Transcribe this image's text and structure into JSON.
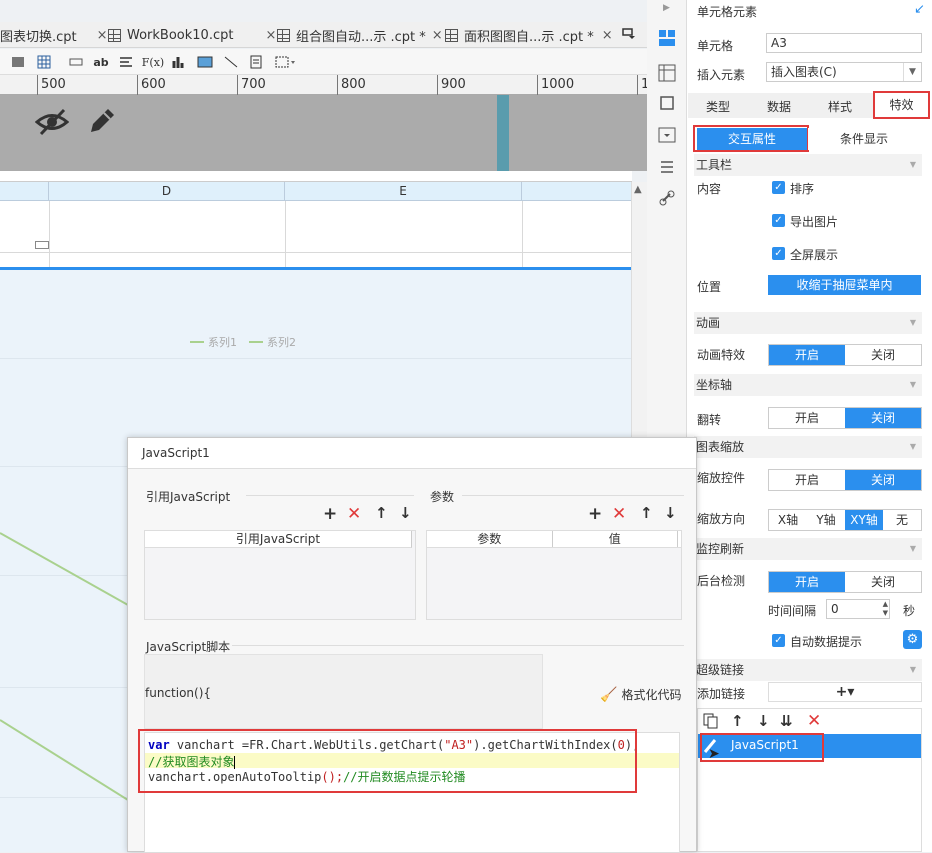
{
  "tabs": [
    {
      "label": "图表切换.cpt",
      "close": "×"
    },
    {
      "label": "WorkBook10.cpt",
      "close": "×"
    },
    {
      "label": "组合图自动...示  .cpt *",
      "close": "×"
    },
    {
      "label": "面积图图自...示  .cpt *",
      "close": "×"
    }
  ],
  "toolbar": {
    "ab": "ab",
    "fx": "F(x)"
  },
  "ruler": {
    "ticks": [
      "500",
      "600",
      "700",
      "800",
      "900",
      "1000",
      "1"
    ]
  },
  "sheet": {
    "columns": [
      "D",
      "E"
    ],
    "legend": [
      "系列1",
      "系列2"
    ]
  },
  "panel": {
    "title": "单元格元素",
    "cell_label": "单元格",
    "cell_value": "A3",
    "insert_label": "插入元素",
    "insert_value": "插入图表(C)",
    "tabs": [
      "类型",
      "数据",
      "样式",
      "特效"
    ],
    "subtabs": [
      "交互属性",
      "条件显示"
    ],
    "toolbar_section": "工具栏",
    "content_label": "内容",
    "checks": [
      "排序",
      "导出图片",
      "全屏展示"
    ],
    "position_label": "位置",
    "position_value": "收缩于抽屉菜单内",
    "anim_section": "动画",
    "anim_label": "动画特效",
    "on": "开启",
    "off": "关闭",
    "axis_section": "坐标轴",
    "flip_label": "翻转",
    "zoom_section": "图表缩放",
    "zoom_ctrl_label": "缩放控件",
    "zoom_dir_label": "缩放方向",
    "zoom_dirs": [
      "X轴",
      "Y轴",
      "XY轴",
      "无"
    ],
    "monitor_section": "监控刷新",
    "backend_label": "后台检测",
    "interval_label": "时间间隔",
    "interval_value": "0",
    "interval_unit": "秒",
    "auto_tip": "自动数据提示",
    "link_section": "超级链接",
    "add_link": "添加链接",
    "add_btn": "+▾",
    "link_item": "JavaScript1"
  },
  "dialog": {
    "title": "JavaScript1",
    "ref_section": "引用JavaScript",
    "param_section": "参数",
    "ref_col": "引用JavaScript",
    "param_col": "参数",
    "value_col": "值",
    "script_section": "JavaScript脚本",
    "func_head": "function(){",
    "format_btn": "格式化代码",
    "code": {
      "l1_kw": "var",
      "l1_a": " vanchart =FR.Chart.WebUtils.getChart(",
      "l1_str": "\"A3\"",
      "l1_b": ").getChartWithIndex(",
      "l1_num": "0",
      "l1_c": ");",
      "l2": "//获取图表对象",
      "l3_a": "vanchart.openAutoTooltip",
      "l3_b": "();",
      "l3_c": "//开启数据点提示轮播"
    }
  },
  "colors": {
    "accent": "#2b8fee",
    "highlight": "#e03a3a",
    "line": "#a9d18e"
  }
}
